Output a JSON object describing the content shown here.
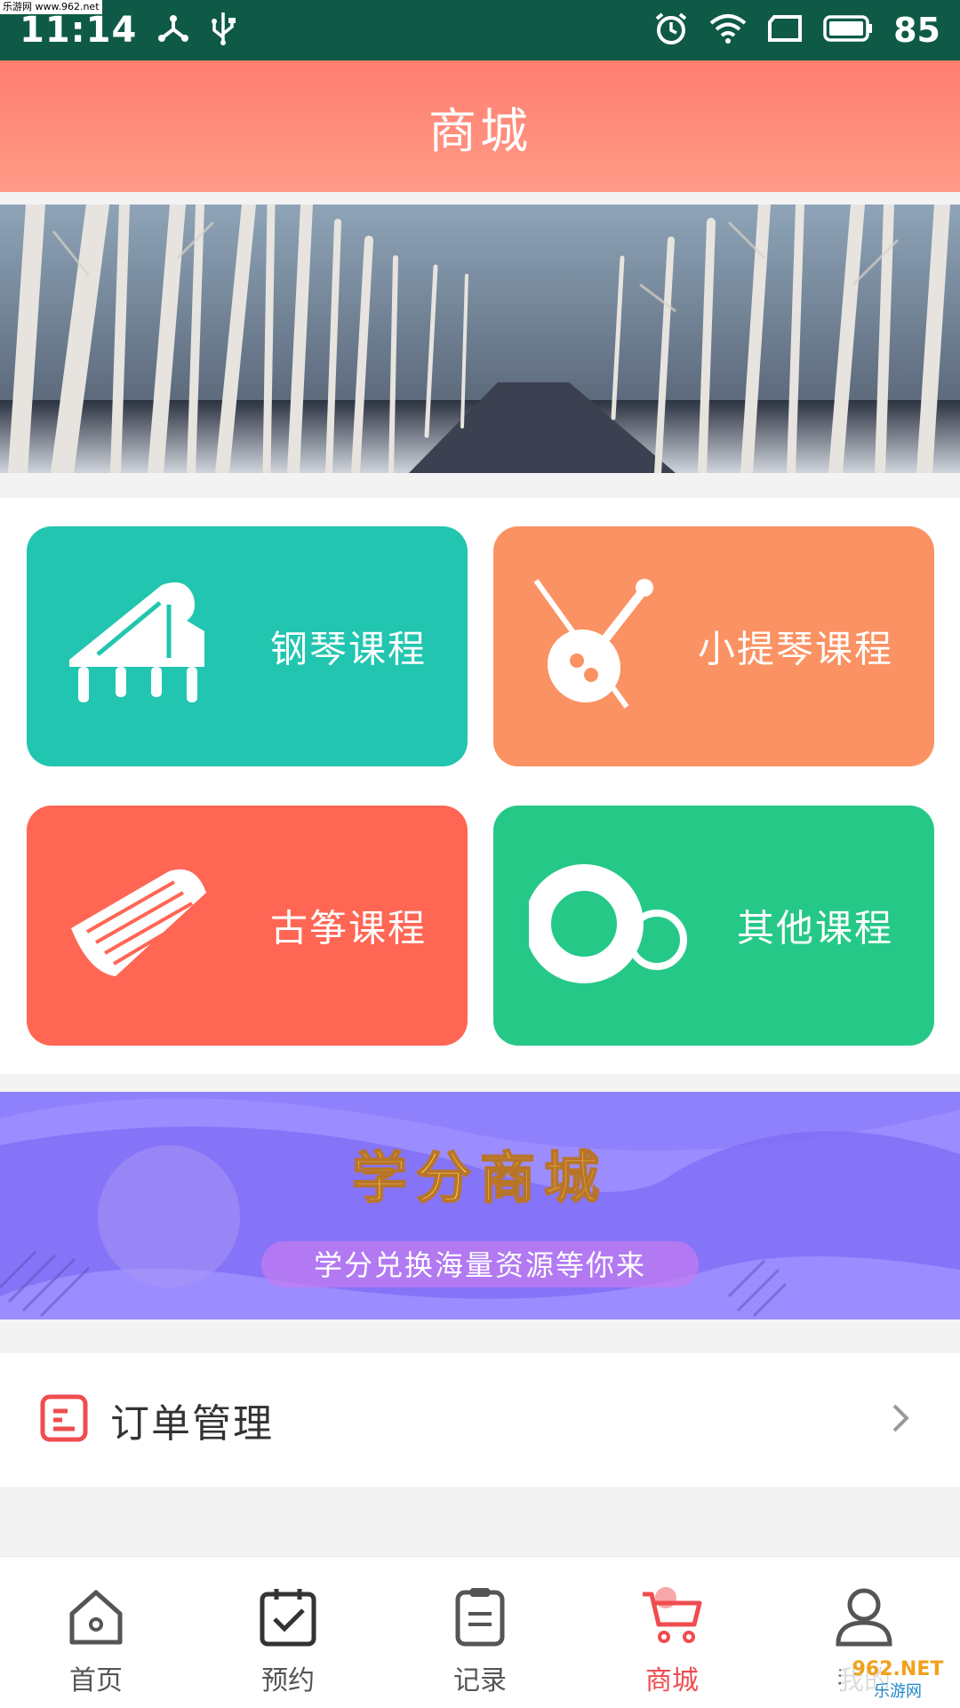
{
  "status_bar": {
    "time": "11:14",
    "battery": "85",
    "watermark": "乐游网 www.962.net"
  },
  "header": {
    "title": "商城"
  },
  "courses": [
    {
      "label": "钢琴课程",
      "icon": "piano-icon",
      "color": "#22c5b0"
    },
    {
      "label": "小提琴课程",
      "icon": "violin-icon",
      "color": "#fb9263"
    },
    {
      "label": "古筝课程",
      "icon": "guzheng-icon",
      "color": "#ff6654"
    },
    {
      "label": "其他课程",
      "icon": "circles-icon",
      "color": "#26c888"
    }
  ],
  "promo": {
    "title": "学分商城",
    "subtitle": "学分兑换海量资源等你来"
  },
  "order": {
    "label": "订单管理"
  },
  "bottom_nav": [
    {
      "label": "首页",
      "icon": "home-icon",
      "active": false
    },
    {
      "label": "预约",
      "icon": "calendar-check-icon",
      "active": false
    },
    {
      "label": "记录",
      "icon": "clipboard-icon",
      "active": false
    },
    {
      "label": "商城",
      "icon": "cart-icon",
      "active": true
    },
    {
      "label": "我的",
      "icon": "user-icon",
      "active": false
    }
  ],
  "watermark_bottom": {
    "top": "962.NET",
    "bottom": "乐游网"
  },
  "colors": {
    "status_bar": "#0f5a46",
    "header": "#ff8a7c",
    "active_tab": "#f04c50"
  }
}
